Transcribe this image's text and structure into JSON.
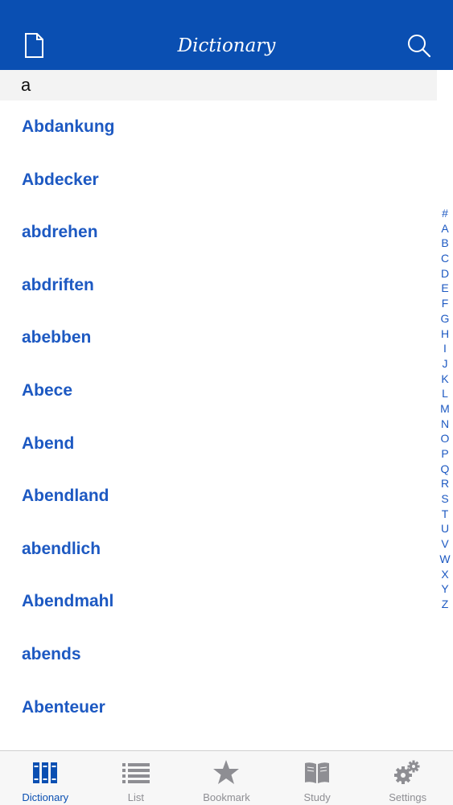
{
  "header": {
    "title": "Dictionary"
  },
  "section": {
    "label": "a"
  },
  "entries": [
    "Abdankung",
    "Abdecker",
    "abdrehen",
    "abdriften",
    "abebben",
    "Abece",
    "Abend",
    "Abendland",
    "abendlich",
    "Abendmahl",
    "abends",
    "Abenteuer"
  ],
  "index": [
    "#",
    "A",
    "B",
    "C",
    "D",
    "E",
    "F",
    "G",
    "H",
    "I",
    "J",
    "K",
    "L",
    "M",
    "N",
    "O",
    "P",
    "Q",
    "R",
    "S",
    "T",
    "U",
    "V",
    "W",
    "X",
    "Y",
    "Z"
  ],
  "tabs": [
    {
      "label": "Dictionary",
      "icon": "books-icon",
      "active": true
    },
    {
      "label": "List",
      "icon": "list-icon",
      "active": false
    },
    {
      "label": "Bookmark",
      "icon": "star-icon",
      "active": false
    },
    {
      "label": "Study",
      "icon": "open-book-icon",
      "active": false
    },
    {
      "label": "Settings",
      "icon": "gear-icon",
      "active": false
    }
  ],
  "colors": {
    "header_bg": "#0a4fb2",
    "entry_text": "#1d59c2",
    "tab_active": "#0a4fb2",
    "tab_inactive": "#8e8e93"
  }
}
